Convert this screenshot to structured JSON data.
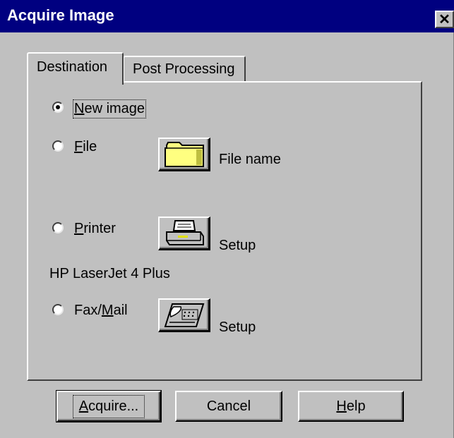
{
  "window": {
    "title": "Acquire Image"
  },
  "tabs": [
    {
      "label": "Destination"
    },
    {
      "label": "Post Processing"
    }
  ],
  "destination": {
    "new_image": {
      "label": "New image",
      "checked": true
    },
    "file": {
      "label": "File",
      "button_icon": "folder-icon",
      "button_caption": "File name"
    },
    "printer": {
      "label": "Printer",
      "button_icon": "printer-icon",
      "button_caption": "Setup",
      "device_name": "HP LaserJet 4 Plus"
    },
    "fax_mail": {
      "label": "Fax/Mail",
      "button_icon": "fax-icon",
      "button_caption": "Setup"
    }
  },
  "buttons": {
    "acquire": "Acquire...",
    "cancel": "Cancel",
    "help": "Help"
  },
  "colors": {
    "titlebar": "#000080",
    "face": "#c0c0c0",
    "folder": "#ffff80"
  }
}
